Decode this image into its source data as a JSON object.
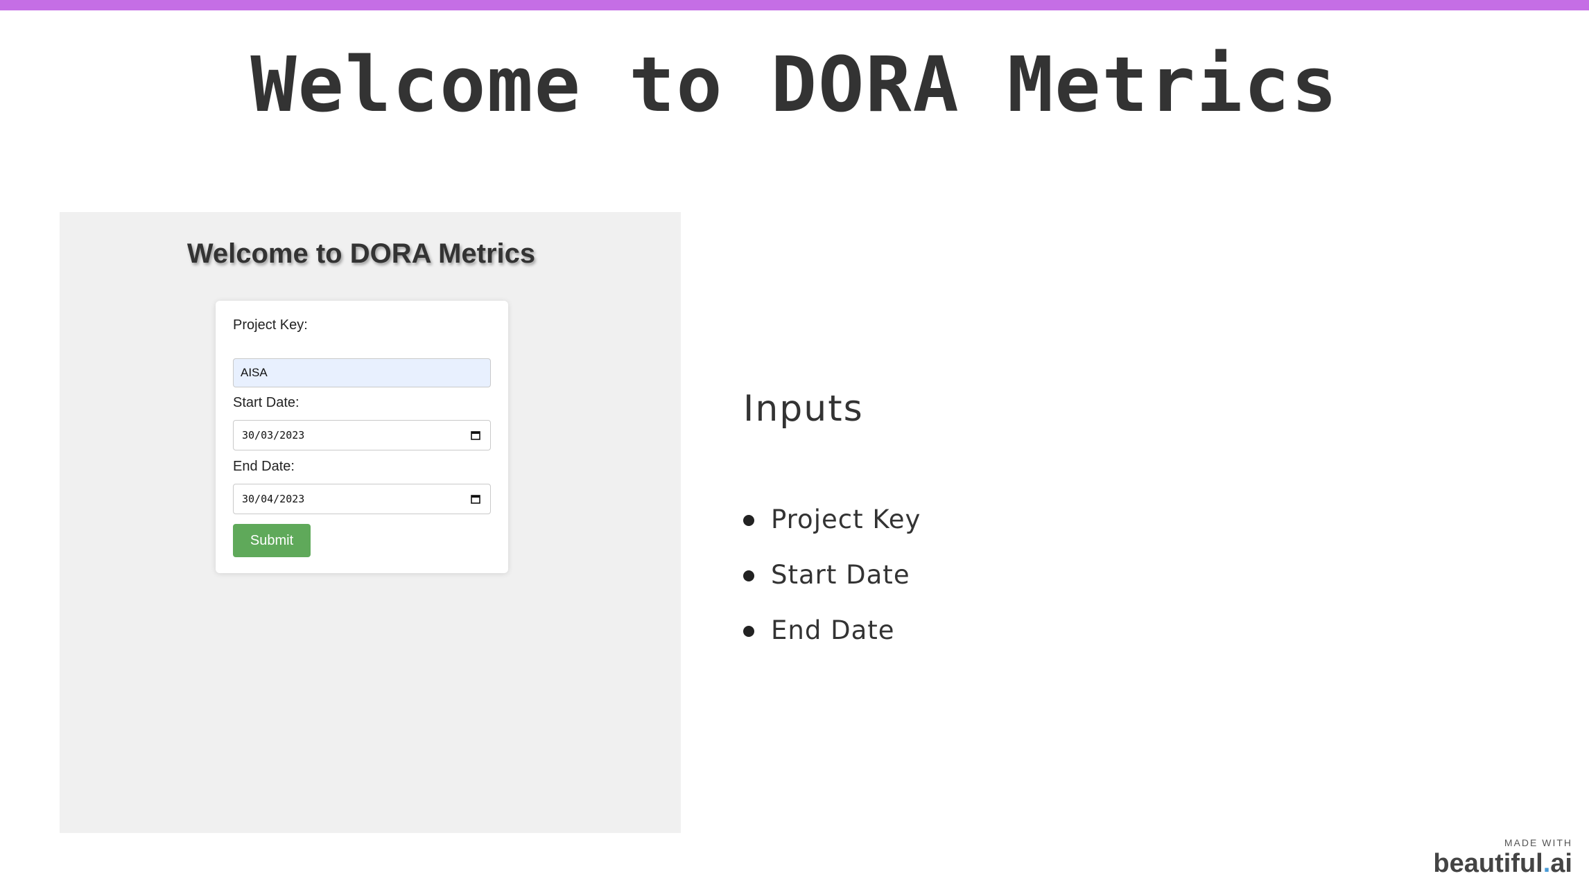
{
  "colors": {
    "top_bar": "#c56ee5",
    "submit_green": "#5fa95a",
    "brand_dot": "#4a9bd6"
  },
  "slide": {
    "title": "Welcome to DORA Metrics"
  },
  "app_screenshot": {
    "title": "Welcome to DORA Metrics",
    "form": {
      "project_key_label": "Project Key:",
      "project_key_value": "AISA",
      "start_date_label": "Start Date:",
      "start_date_value": "30/03/2023",
      "end_date_label": "End Date:",
      "end_date_value": "30/04/2023",
      "submit_label": "Submit"
    }
  },
  "inputs_section": {
    "heading": "Inputs",
    "items": [
      "Project Key",
      "Start Date",
      "End Date"
    ]
  },
  "credit": {
    "made_with": "MADE WITH",
    "brand_name": "beautiful",
    "brand_dot": ".",
    "brand_suffix": "ai"
  },
  "icons": {
    "calendar": "calendar-icon",
    "bullet": "bullet-dot-icon"
  }
}
